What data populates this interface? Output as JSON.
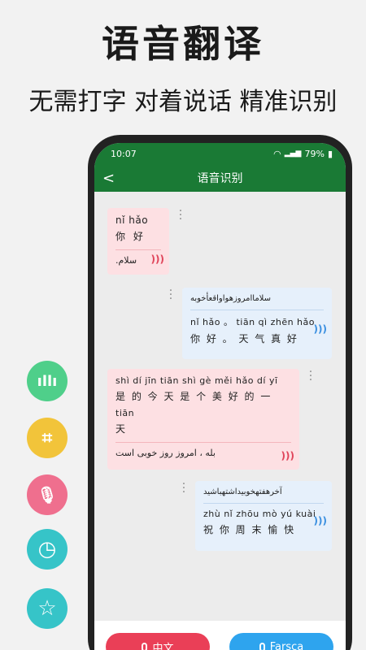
{
  "promo": {
    "headline": "语音翻译",
    "subline": "无需打字 对着说话 精准识别"
  },
  "side_icons": [
    {
      "name": "waveform-icon",
      "color": "#4fcf8a",
      "glyph": "ıllı"
    },
    {
      "name": "face-scan-icon",
      "color": "#f2c43a",
      "glyph": "⌗"
    },
    {
      "name": "microphone-icon",
      "color": "#ef6f8e",
      "glyph": "🎙"
    },
    {
      "name": "clock-icon",
      "color": "#36c4c8",
      "glyph": "◷"
    },
    {
      "name": "star-icon",
      "color": "#36c4c8",
      "glyph": "☆"
    }
  ],
  "status_bar": {
    "time": "10:07",
    "battery": "79%"
  },
  "app_bar": {
    "back_glyph": "<",
    "title": "语音识别"
  },
  "messages": [
    {
      "side": "left",
      "pinyin_lines": [
        "nǐ hǎo"
      ],
      "hanzi_lines": [
        "你 好"
      ],
      "translation": "سلام."
    },
    {
      "side": "right",
      "source_text": "سلاماامروزهواواقعأخوبه",
      "pinyin_lines": [
        "nǐ hǎo 。 tiān qì zhēn hǎo"
      ],
      "hanzi_lines": [
        "你 好 。 天 气 真 好"
      ]
    },
    {
      "side": "left",
      "pinyin_lines": [
        "shì dí jīn tiān shì gè měi hǎo dí yī",
        "tiān"
      ],
      "hanzi_lines": [
        "是 的 今 天 是 个 美 好 的 一",
        "天"
      ],
      "translation": "بله ، امروز روز خوبی است"
    },
    {
      "side": "right",
      "source_text": "آخرهفتهخوبيداشتهباشيد",
      "pinyin_lines": [
        "zhù nǐ zhōu mò yú kuài"
      ],
      "hanzi_lines": [
        "祝 你 周 末 愉 快"
      ]
    }
  ],
  "bottom_bar": {
    "chinese_button": "中文",
    "farsi_button": "Farsça",
    "chinese_color": "#ea3f57",
    "farsi_color": "#2ea4ee"
  }
}
